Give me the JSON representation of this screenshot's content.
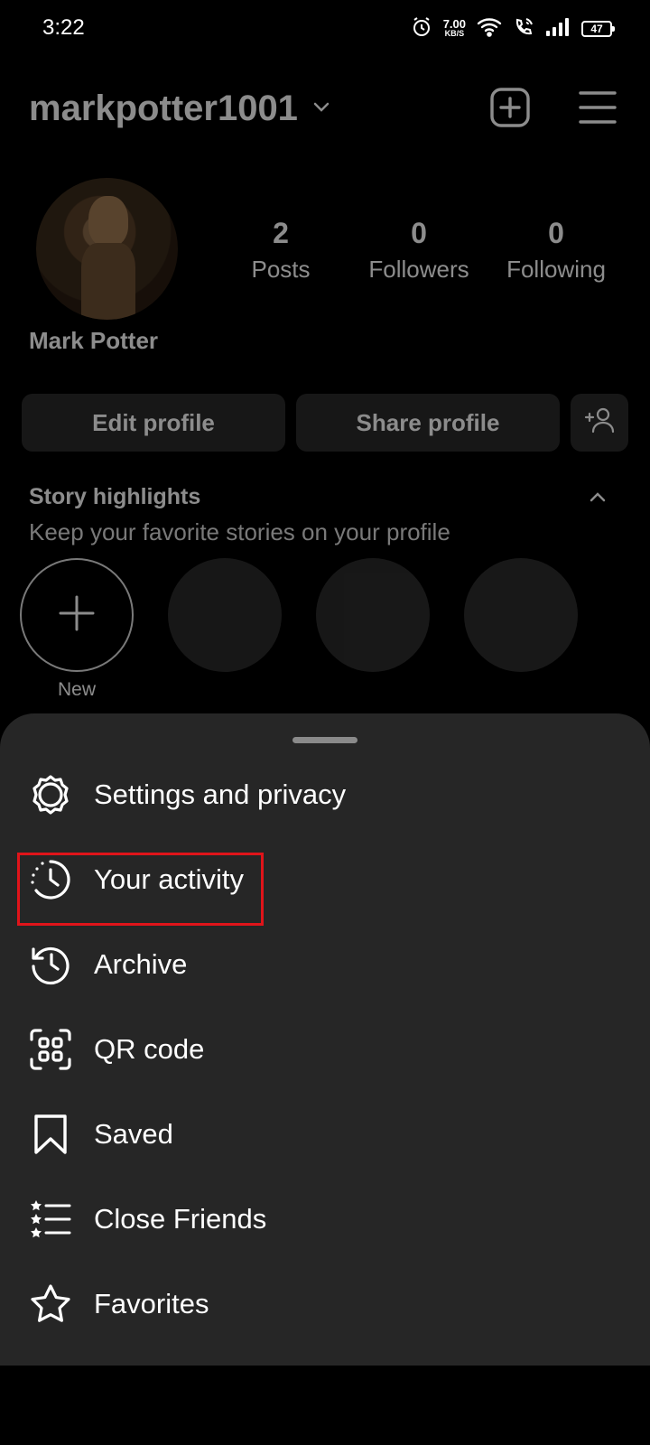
{
  "status_bar": {
    "time": "3:22",
    "net_speed_value": "7.00",
    "net_speed_unit": "KB/S",
    "battery": "47"
  },
  "profile": {
    "username": "markpotter1001",
    "full_name": "Mark Potter",
    "stats": {
      "posts": {
        "value": "2",
        "label": "Posts"
      },
      "followers": {
        "value": "0",
        "label": "Followers"
      },
      "following": {
        "value": "0",
        "label": "Following"
      }
    },
    "buttons": {
      "edit_profile": "Edit profile",
      "share_profile": "Share profile"
    },
    "highlights": {
      "title": "Story highlights",
      "subtitle": "Keep your favorite stories on your profile",
      "new_label": "New"
    }
  },
  "menu": {
    "items": [
      {
        "label": "Settings and privacy",
        "icon": "settings-gear-icon"
      },
      {
        "label": "Your activity",
        "icon": "activity-clock-icon",
        "highlighted": true
      },
      {
        "label": "Archive",
        "icon": "archive-history-icon"
      },
      {
        "label": "QR code",
        "icon": "qr-code-icon"
      },
      {
        "label": "Saved",
        "icon": "bookmark-icon"
      },
      {
        "label": "Close Friends",
        "icon": "close-friends-list-icon"
      },
      {
        "label": "Favorites",
        "icon": "star-icon"
      }
    ],
    "highlight_color": "#e0141a"
  }
}
